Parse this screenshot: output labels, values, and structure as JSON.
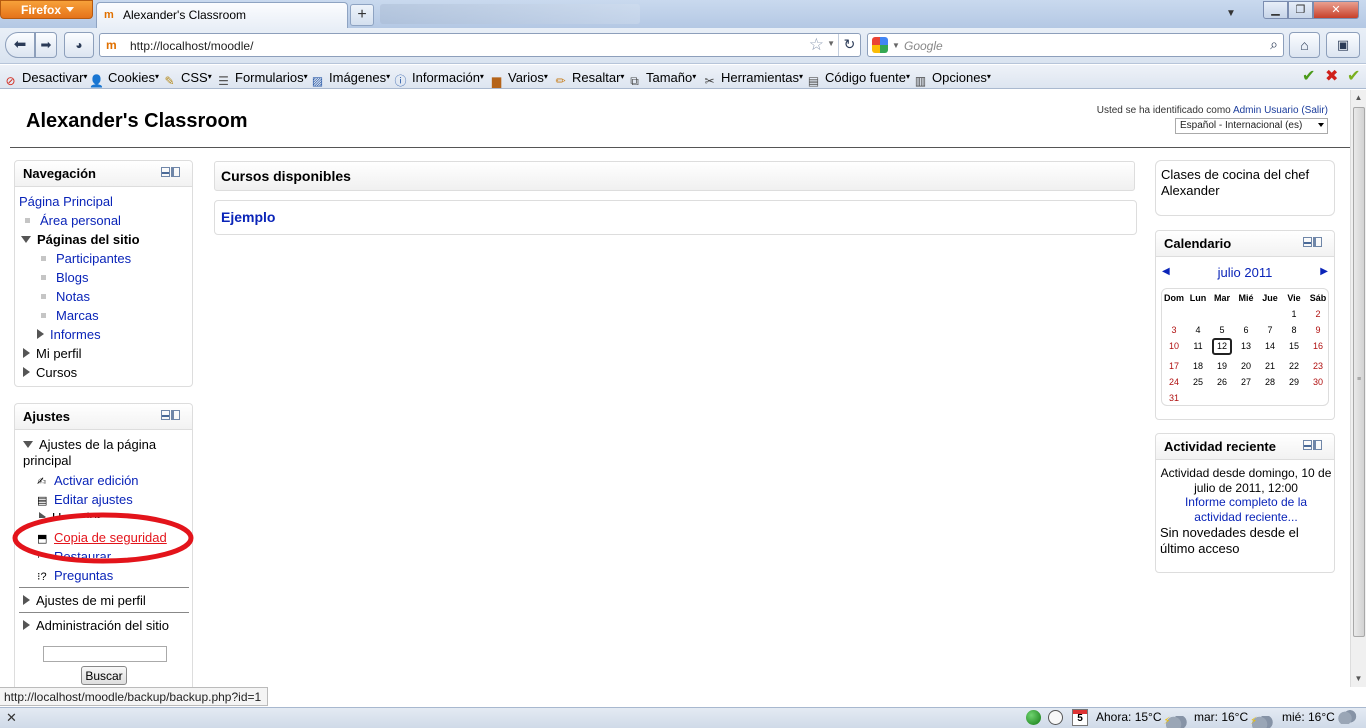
{
  "browser": {
    "menu_button": "Firefox",
    "tab_title": "Alexander's Classroom",
    "url": "http://localhost/moodle/",
    "search_placeholder": "Google",
    "hover_url": "http://localhost/moodle/backup/backup.php?id=1"
  },
  "webdev_toolbar": [
    {
      "label": "Desactivar",
      "icon": "disable-icon",
      "color": "#d22a1e"
    },
    {
      "label": "Cookies",
      "icon": "person-icon",
      "color": "#444"
    },
    {
      "label": "CSS",
      "icon": "pencil-icon",
      "color": "#b58a1a"
    },
    {
      "label": "Formularios",
      "icon": "form-icon",
      "color": "#555"
    },
    {
      "label": "Imágenes",
      "icon": "image-icon",
      "color": "#2a5aa8"
    },
    {
      "label": "Información",
      "icon": "info-icon",
      "color": "#2a5aa8"
    },
    {
      "label": "Varios",
      "icon": "toolbox-icon",
      "color": "#b5641a"
    },
    {
      "label": "Resaltar",
      "icon": "highlighter-icon",
      "color": "#c77d1a"
    },
    {
      "label": "Tamaño",
      "icon": "resize-icon",
      "color": "#444"
    },
    {
      "label": "Herramientas",
      "icon": "tools-icon",
      "color": "#444"
    },
    {
      "label": "Código fuente",
      "icon": "document-icon",
      "color": "#555"
    },
    {
      "label": "Opciones",
      "icon": "options-icon",
      "color": "#444"
    }
  ],
  "header": {
    "site_title": "Alexander's Classroom",
    "login_prefix": "Usted se ha identificado como",
    "user_name": "Admin Usuario",
    "logout": "(Salir)",
    "language": "Español - Internacional (es)"
  },
  "navigation": {
    "title": "Navegación",
    "items": {
      "home": "Página Principal",
      "my_home": "Área personal",
      "site_pages": "Páginas del sitio",
      "participants": "Participantes",
      "blogs": "Blogs",
      "notes": "Notas",
      "tags": "Marcas",
      "reports": "Informes",
      "my_profile": "Mi perfil",
      "courses": "Cursos"
    }
  },
  "settings": {
    "title": "Ajustes",
    "front_page": "Ajustes de la página principal",
    "turn_editing_on": "Activar edición",
    "edit_settings": "Editar ajustes",
    "users": "Usuarios",
    "backup": "Copia de seguridad",
    "restore": "Restaurar",
    "questions": "Preguntas",
    "my_profile_settings": "Ajustes de mi perfil",
    "site_admin": "Administración del sitio",
    "search_button": "Buscar",
    "search_value": ""
  },
  "main": {
    "heading": "Cursos disponibles",
    "course": "Ejemplo"
  },
  "summary": "Clases de cocina del chef Alexander",
  "calendar": {
    "title": "Calendario",
    "month": "julio 2011",
    "prev": "◀",
    "next": "▶",
    "days_of_week": [
      "Dom",
      "Lun",
      "Mar",
      "Mié",
      "Jue",
      "Vie",
      "Sáb"
    ],
    "weeks": [
      [
        "",
        "",
        "",
        "",
        "",
        "1",
        "2"
      ],
      [
        "3",
        "4",
        "5",
        "6",
        "7",
        "8",
        "9"
      ],
      [
        "10",
        "11",
        "12",
        "13",
        "14",
        "15",
        "16"
      ],
      [
        "17",
        "18",
        "19",
        "20",
        "21",
        "22",
        "23"
      ],
      [
        "24",
        "25",
        "26",
        "27",
        "28",
        "29",
        "30"
      ],
      [
        "31",
        "",
        "",
        "",
        "",
        "",
        ""
      ]
    ],
    "today": "12",
    "weekend_color": "#b01010"
  },
  "recent_activity": {
    "title": "Actividad reciente",
    "since": "Actividad desde domingo, 10 de julio de 2011, 12:00",
    "full_report": "Informe completo de la actividad reciente...",
    "none": "Sin novedades desde el último acceso"
  },
  "statusbar": {
    "calendar_day": "5",
    "weather_now": "Ahora: 15°C",
    "weather_tue": "mar: 16°C",
    "weather_wed": "mié: 16°C"
  },
  "annotation": {
    "color": "#e3141b"
  }
}
